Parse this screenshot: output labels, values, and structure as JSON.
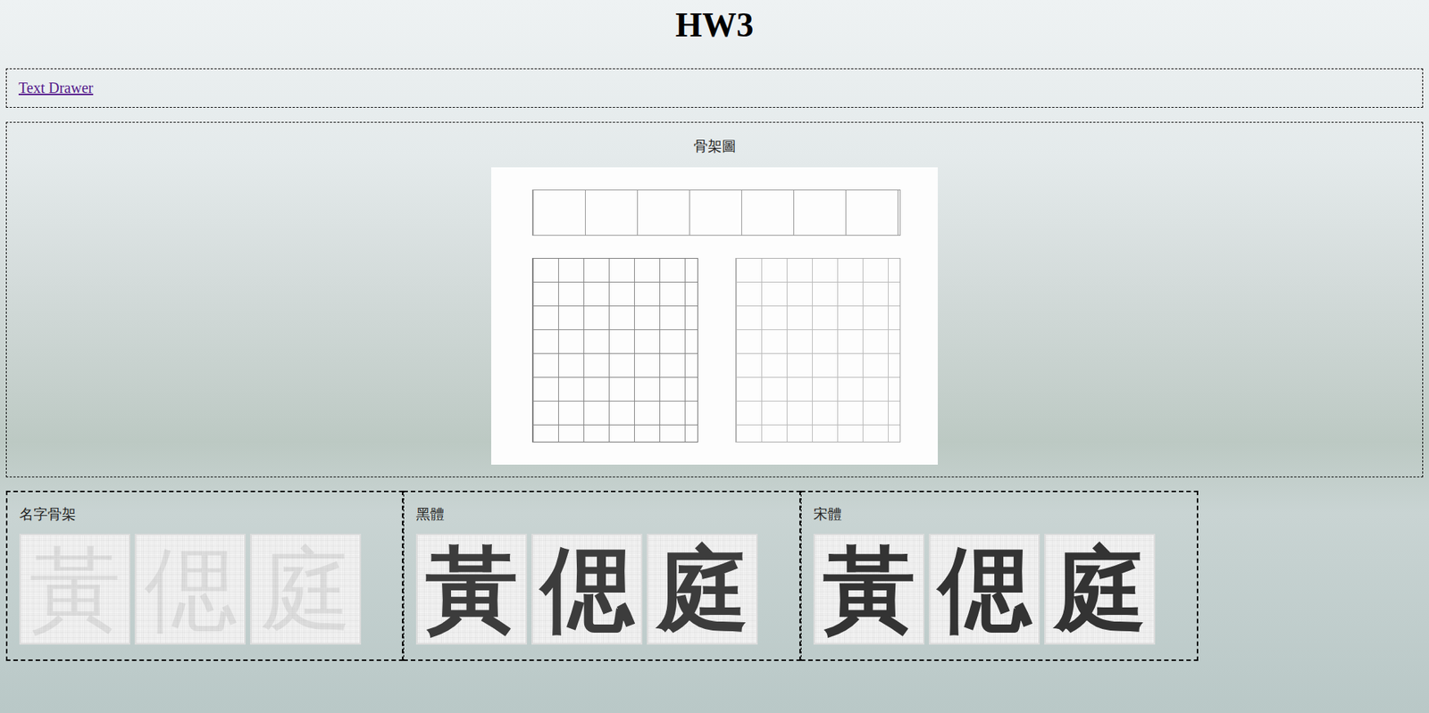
{
  "page_title": "HW3",
  "nav": {
    "links": [
      {
        "label": "Text Drawer",
        "visited": true
      }
    ]
  },
  "skeleton_figure": {
    "title": "骨架圖"
  },
  "panels": [
    {
      "title": "名字骨架",
      "kind": "skeleton",
      "chars": [
        "黃",
        "偲",
        "庭"
      ]
    },
    {
      "title": "黑體",
      "kind": "sans",
      "chars": [
        "黃",
        "偲",
        "庭"
      ]
    },
    {
      "title": "宋體",
      "kind": "serif",
      "chars": [
        "黃",
        "偲",
        "庭"
      ]
    }
  ]
}
